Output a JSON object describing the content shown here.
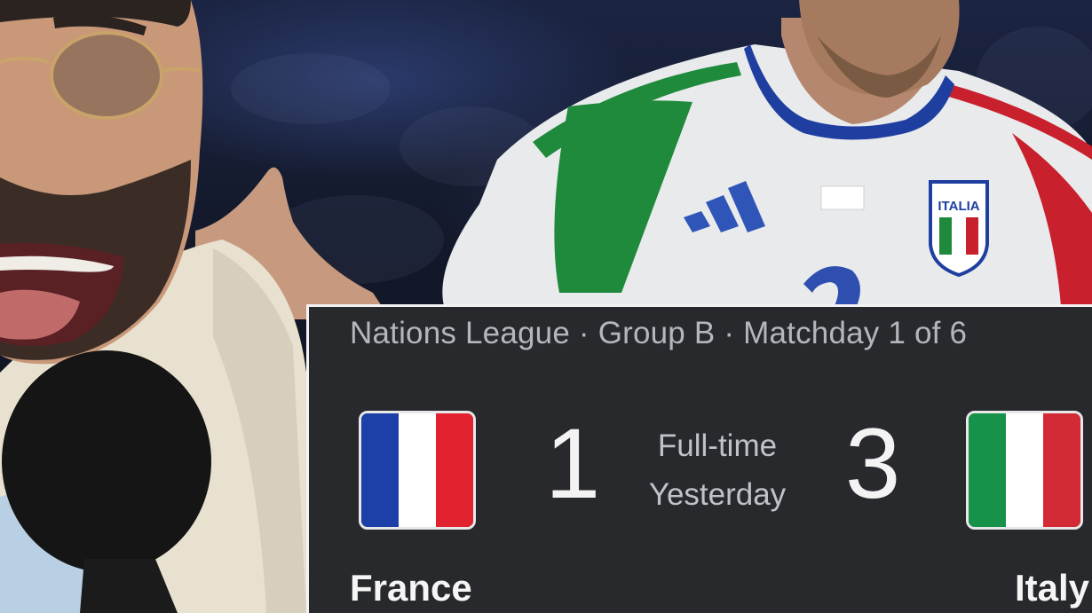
{
  "match": {
    "competition_line": "Nations League · Group B · Matchday 1 of 6",
    "status": "Full-time",
    "when": "Yesterday",
    "home": {
      "name": "France",
      "score": "1",
      "flag_colors": [
        "#1c3fa8",
        "#ffffff",
        "#e2232f"
      ]
    },
    "away": {
      "name": "Italy",
      "score": "3",
      "flag_colors": [
        "#17924a",
        "#ffffff",
        "#d32b35"
      ]
    }
  },
  "jersey_text": "ITALIA",
  "colors": {
    "card_background": "#28292d",
    "card_border": "#f2f2f2",
    "header_text": "#b3b6bb",
    "score_text": "#f3f3f3"
  }
}
